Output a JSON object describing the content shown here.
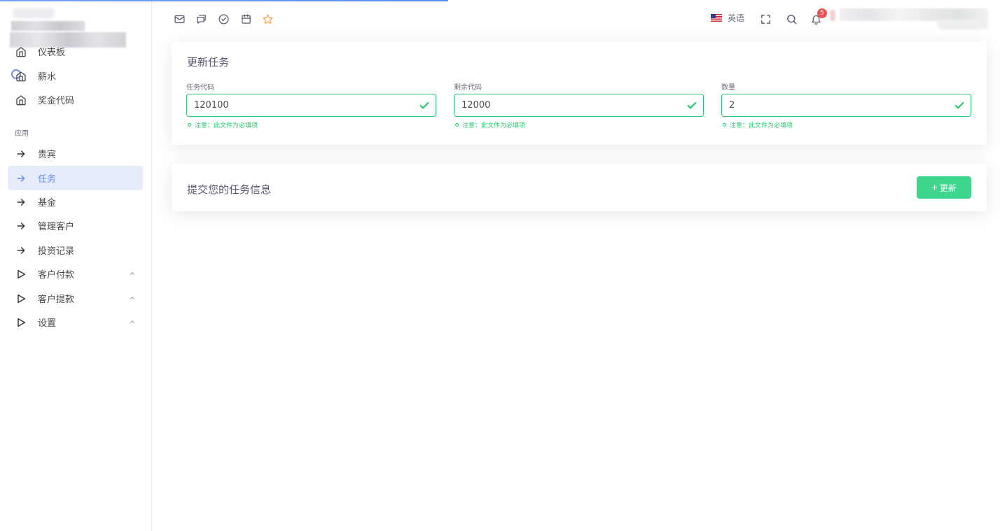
{
  "sidebar": {
    "items_top": [
      {
        "label": "仪表板",
        "icon": "home-icon"
      },
      {
        "label": "薪水",
        "icon": "home-icon"
      },
      {
        "label": "奖金代码",
        "icon": "home-icon"
      }
    ],
    "section_label": "应用",
    "items_apps": [
      {
        "label": "贵宾",
        "icon": "arrow-right-icon"
      },
      {
        "label": "任务",
        "icon": "arrow-right-icon",
        "active": true
      },
      {
        "label": "基金",
        "icon": "arrow-right-icon"
      },
      {
        "label": "管理客户",
        "icon": "arrow-right-icon"
      },
      {
        "label": "投资记录",
        "icon": "arrow-right-icon"
      },
      {
        "label": "客户付款",
        "icon": "play-icon",
        "expandable": true
      },
      {
        "label": "客户提款",
        "icon": "play-icon",
        "expandable": true
      },
      {
        "label": "设置",
        "icon": "play-icon",
        "expandable": true
      }
    ]
  },
  "topbar": {
    "icons": [
      "mail-icon",
      "chat-icon",
      "check-circle-icon",
      "calendar-icon",
      "star-icon"
    ],
    "language": "英语",
    "notification_count": "5"
  },
  "update_card": {
    "title": "更新任务",
    "fields": [
      {
        "label": "任务代码",
        "value": "120100",
        "hint": "注意：此文件为必填项"
      },
      {
        "label": "剩余代码",
        "value": "12000",
        "hint": "注意：此文件为必填项"
      },
      {
        "label": "数量",
        "value": "2",
        "hint": "注意：此文件为必填项"
      }
    ]
  },
  "submit_card": {
    "title": "提交您的任务信息",
    "button_label": "更新"
  },
  "colors": {
    "accent": "#7367f0",
    "success": "#28c76f",
    "button": "#3dd68c",
    "active_bg": "#e6ecf9",
    "badge": "#ea5455",
    "star": "#ff9f43"
  }
}
